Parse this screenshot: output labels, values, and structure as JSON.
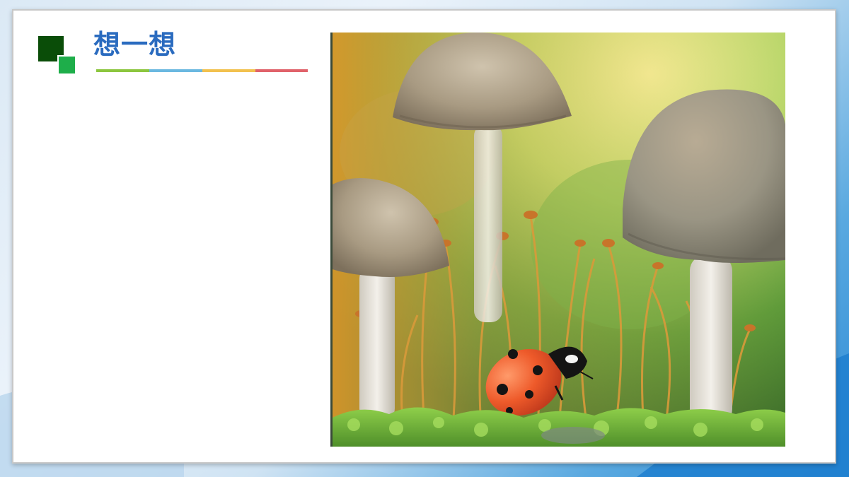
{
  "title": "想一想",
  "colors": {
    "title": "#2a6bbf",
    "logo_dark": "#0a4d08",
    "logo_light": "#1eae4a",
    "rule_segments": [
      "#8cc63f",
      "#6bb8e0",
      "#f2c14e",
      "#e0626a"
    ]
  },
  "image": {
    "subject": "mushrooms-and-ladybug-on-moss"
  }
}
